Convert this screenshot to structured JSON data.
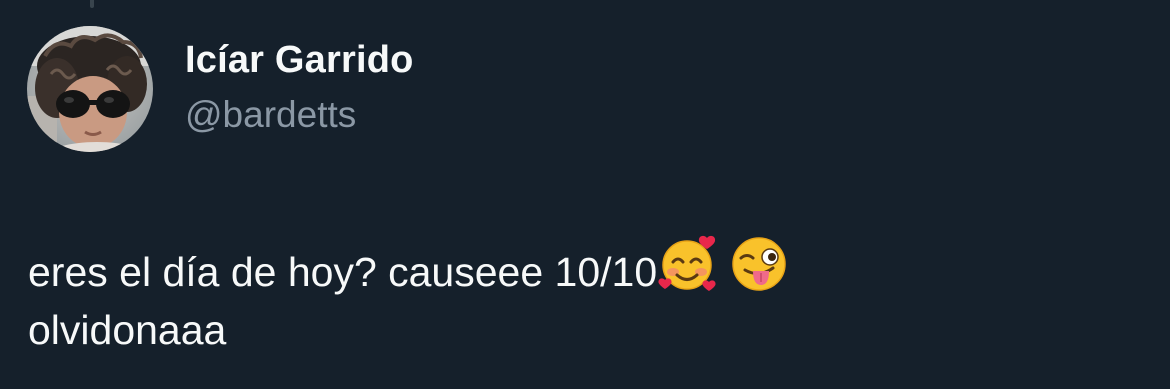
{
  "author": {
    "display_name": "Icíar Garrido",
    "handle": "@bardetts",
    "avatar": "profile-photo"
  },
  "tweet": {
    "line1_text": "eres el día de hoy? causeee 10/10",
    "line2_text": "olvidonaaa",
    "emojis": [
      "smiling-face-with-hearts-emoji",
      "winking-face-with-tongue-emoji"
    ]
  },
  "colors": {
    "background": "#15202b",
    "primary_text": "#f7f9f9",
    "secondary_text": "#8b98a5",
    "thread_line": "#38444d"
  }
}
